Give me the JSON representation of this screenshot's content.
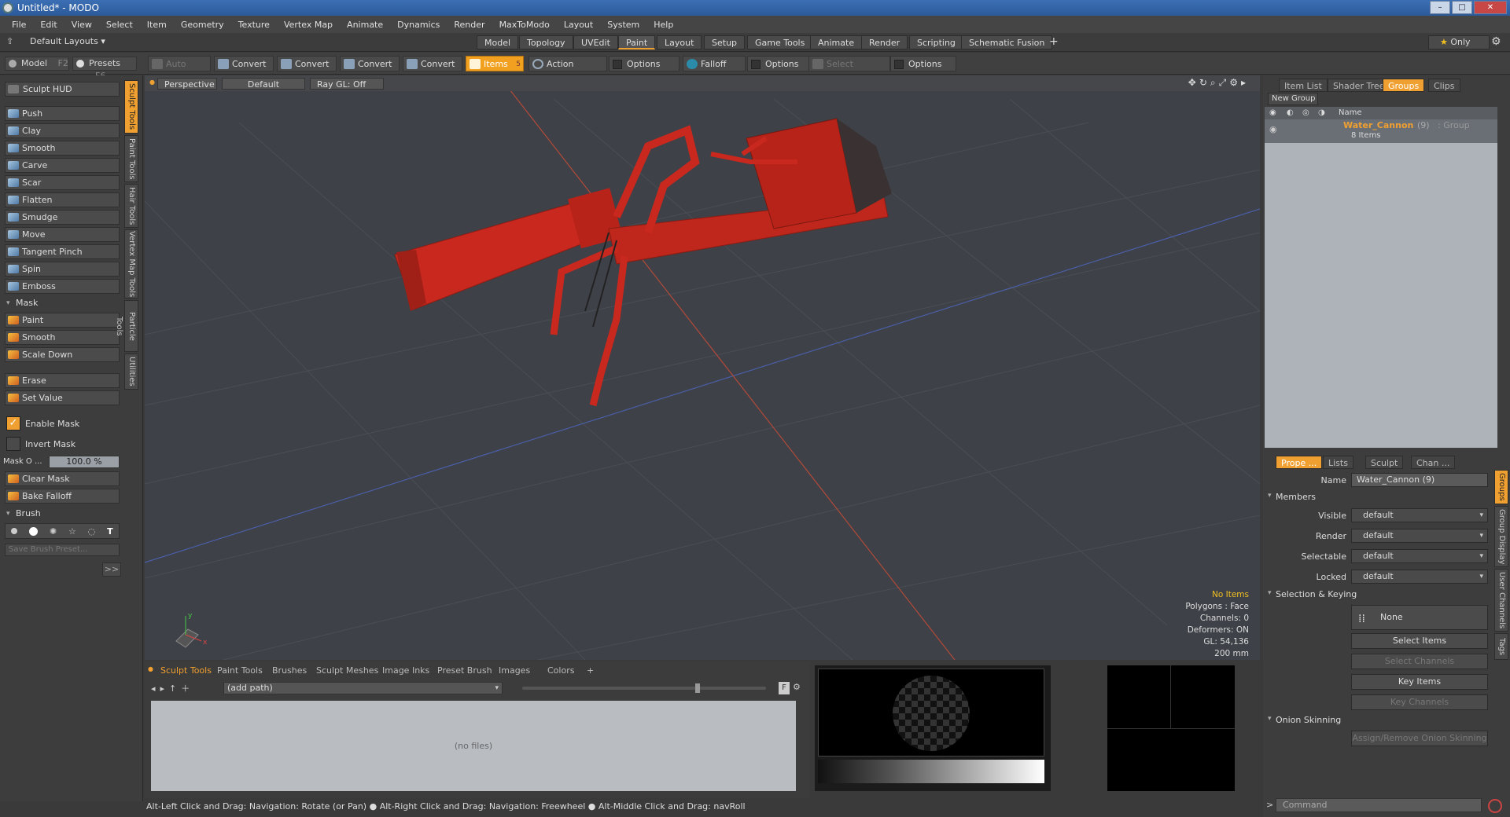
{
  "window": {
    "title": "Untitled* - MODO"
  },
  "menu": [
    "File",
    "Edit",
    "View",
    "Select",
    "Item",
    "Geometry",
    "Texture",
    "Vertex Map",
    "Animate",
    "Dynamics",
    "Render",
    "MaxToModo",
    "Layout",
    "System",
    "Help"
  ],
  "layoutbar": {
    "layouts_label": "Default Layouts",
    "tabs": [
      "Model",
      "Topology",
      "UVEdit",
      "Paint",
      "Layout",
      "Setup",
      "Game Tools",
      "Animate",
      "Render",
      "Scripting",
      "Schematic Fusion"
    ],
    "active_tab": "Paint",
    "plus": "+",
    "only_label": "Only"
  },
  "toolbar": {
    "model": "Model",
    "model_key": "F2",
    "presets": "Presets",
    "presets_key": "F6",
    "auto_select": "Auto Select",
    "convert1": "Convert",
    "convert2": "Convert",
    "convert3": "Convert",
    "convert4": "Convert",
    "items": "Items",
    "items_key": "5",
    "action_center": "Action Center",
    "options1": "Options",
    "falloff": "Falloff",
    "options2": "Options",
    "select_through": "Select Through",
    "options3": "Options"
  },
  "left": {
    "sculpt_hud": "Sculpt HUD",
    "tools": [
      "Push",
      "Clay",
      "Smooth",
      "Carve",
      "Scar",
      "Flatten",
      "Smudge",
      "Move",
      "Tangent Pinch",
      "Spin",
      "Emboss"
    ],
    "mask_header": "Mask",
    "mask_tools": [
      "Paint",
      "Smooth",
      "Scale Down"
    ],
    "erase": "Erase",
    "set_value": "Set Value",
    "enable_mask": "Enable Mask",
    "invert_mask": "Invert Mask",
    "mask_opacity_label": "Mask O ...",
    "mask_opacity_value": "100.0 %",
    "clear_mask": "Clear Mask",
    "bake_falloff": "Bake Falloff",
    "brush_header": "Brush",
    "save_brush": "Save Brush Preset...",
    "more": ">>",
    "vtabs": [
      "Sculpt Tools",
      "Paint Tools",
      "Hair Tools",
      "Vertex Map Tools",
      "Particle Tools",
      "Utilities"
    ]
  },
  "viewport": {
    "view": "Perspective",
    "shading": "Default",
    "raygl": "Ray GL: Off",
    "hud": {
      "items": "No Items",
      "polygons": "Polygons : Face",
      "channels": "Channels: 0",
      "deformers": "Deformers: ON",
      "gl": "GL: 54,136",
      "scale": "200 mm"
    }
  },
  "bottom": {
    "tabs": [
      "Sculpt Tools",
      "Paint Tools",
      "Brushes",
      "Sculpt Meshes",
      "Image Inks",
      "Preset Brush",
      "Images",
      "Colors"
    ],
    "active_tab": "Sculpt Tools",
    "plus": "+",
    "path": "(add path)",
    "no_files": "(no files)",
    "f_btn": "F"
  },
  "right": {
    "top_tabs": [
      "Item List",
      "Shader Tree",
      "Groups",
      "Clips"
    ],
    "active_top_tab": "Groups",
    "new_group": "New Group",
    "name_col": "Name",
    "group_name": "Water_Cannon",
    "group_count": "(9)",
    "group_type": ": Group",
    "group_items": "8 Items",
    "prop_tabs": [
      "Prope ...",
      "Lists",
      "Sculpt",
      "Chan ..."
    ],
    "active_prop_tab": "Prope ...",
    "name_label": "Name",
    "name_value": "Water_Cannon (9)",
    "members_header": "Members",
    "visible_label": "Visible",
    "visible_value": "default",
    "render_label": "Render",
    "render_value": "default",
    "selectable_label": "Selectable",
    "selectable_value": "default",
    "locked_label": "Locked",
    "locked_value": "default",
    "sel_keying_header": "Selection & Keying",
    "none_label": "None",
    "select_items": "Select Items",
    "select_channels": "Select Channels",
    "key_items": "Key Items",
    "key_channels": "Key Channels",
    "onion_header": "Onion Skinning",
    "assign_onion": "Assign/Remove Onion Skinning",
    "side_tabs": [
      "Groups",
      "Group Display",
      "User Channels",
      "Tags"
    ]
  },
  "status": {
    "text": "Alt-Left Click and Drag: Navigation: Rotate (or Pan) ● Alt-Right Click and Drag: Navigation: Freewheel ● Alt-Middle Click and Drag: navRoll",
    "command_placeholder": "Command",
    "prompt": ">"
  },
  "colors": {
    "accent": "#f0a030",
    "model": "#c8281e"
  }
}
